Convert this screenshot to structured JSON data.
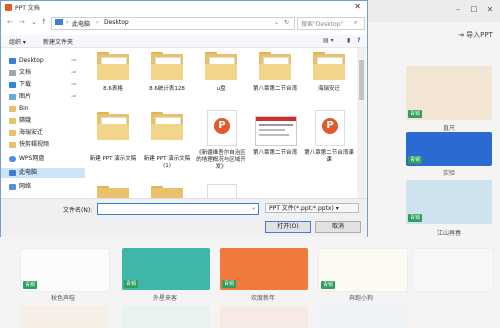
{
  "dialog": {
    "title": "PPT 文档",
    "breadcrumb": [
      "此电脑",
      "Desktop"
    ],
    "search_placeholder": "搜索\"Desktop\"",
    "toolbar": {
      "organize": "组织 ▾",
      "new_folder": "新建文件夹"
    },
    "nav_items": [
      {
        "label": "Desktop",
        "icon": "desktop-icon",
        "pinned": true
      },
      {
        "label": "文档",
        "icon": "documents-icon",
        "pinned": true
      },
      {
        "label": "下载",
        "icon": "download-icon",
        "pinned": true
      },
      {
        "label": "图片",
        "icon": "pictures-icon",
        "pinned": true
      },
      {
        "label": "Bin",
        "icon": "folder-icon"
      },
      {
        "label": "嫦娥",
        "icon": "folder-icon"
      },
      {
        "label": "海瑞安迁",
        "icon": "folder-icon"
      },
      {
        "label": "快剪辑视频",
        "icon": "folder-icon"
      },
      {
        "label": "WPS网盘",
        "icon": "cloud-icon"
      },
      {
        "label": "此电脑",
        "icon": "computer-icon",
        "selected": true
      },
      {
        "label": "网络",
        "icon": "network-icon"
      }
    ],
    "files": [
      {
        "name": "8.6表格",
        "kind": "folder"
      },
      {
        "name": "8.6统计表128",
        "kind": "folder"
      },
      {
        "name": "u盘",
        "kind": "folder"
      },
      {
        "name": "第八章第二节台湾",
        "kind": "folder"
      },
      {
        "name": "海瑞安迁",
        "kind": "folder"
      },
      {
        "name": "新建 PPT 演示文稿",
        "kind": "folder"
      },
      {
        "name": "新建 PPT 演示文稿(1)",
        "kind": "folder"
      },
      {
        "name": "《新疆维吾尔自治区的地理概况与区域开发》",
        "kind": "ppt"
      },
      {
        "name": "第八章第二节台湾",
        "kind": "ppt-thumb"
      },
      {
        "name": "第八章第二节台湾课课",
        "kind": "ppt"
      }
    ],
    "filename_label": "文件名(N):",
    "filename_value": "",
    "filetype": "PPT 文件(*.ppt;*.pptx) ▾",
    "open_button": "打开(O)",
    "cancel_button": "取消"
  },
  "background": {
    "import_ppt": "导入PPT",
    "badge": "青铜",
    "tiles": [
      {
        "caption": "直尺",
        "color": "#f3e5d4"
      },
      {
        "caption": "实验",
        "color": "#2a6bd1"
      },
      {
        "caption": "江山再春",
        "color": "#cfe3ef"
      },
      {
        "caption": "秋色声喧",
        "color": "#ffffff"
      },
      {
        "caption": "外星来客",
        "color": "#3fb7a8"
      },
      {
        "caption": "欢度新年",
        "color": "#f07a3a"
      },
      {
        "caption": "奔跑小狗",
        "color": "#ffffff"
      }
    ]
  },
  "colors": {
    "accent": "#3c7fd1",
    "badge": "#2e9d5f",
    "ppt": "#e05a2b",
    "folder": "#e8c26a"
  }
}
